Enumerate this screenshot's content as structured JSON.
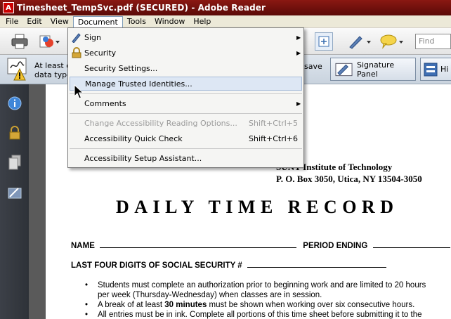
{
  "window": {
    "title": "Timesheet_TempSvc.pdf (SECURED) - Adobe Reader"
  },
  "menubar": {
    "items": [
      "File",
      "Edit",
      "View",
      "Document",
      "Tools",
      "Window",
      "Help"
    ],
    "active": "Document"
  },
  "toolbar": {
    "find_placeholder": "Find",
    "icons": [
      "print-icon",
      "collaborate-icon",
      "fit-page-icon",
      "pen-icon",
      "comment-bubble-icon"
    ]
  },
  "infobar": {
    "message_line1": "At least o",
    "message_line2": "data type",
    "message_right": "save",
    "signature_panel_label": "Signature Panel",
    "highlight_label": "Hi"
  },
  "document_menu": {
    "items": [
      {
        "label": "Sign",
        "submenu": true,
        "icon": "pen-icon"
      },
      {
        "label": "Security",
        "submenu": true,
        "icon": "lock-icon"
      },
      {
        "label": "Security Settings..."
      },
      {
        "label": "Manage Trusted Identities...",
        "highlighted": true
      },
      {
        "label": "Comments",
        "submenu": true
      },
      {
        "label": "Change Accessibility Reading Options...",
        "shortcut": "Shift+Ctrl+5",
        "disabled": true
      },
      {
        "label": "Accessibility Quick Check",
        "shortcut": "Shift+Ctrl+6"
      },
      {
        "label": "Accessibility Setup Assistant..."
      }
    ]
  },
  "navpane": {
    "icons": [
      "info-icon",
      "lock-icon",
      "pages-icon",
      "signatures-icon"
    ]
  },
  "document": {
    "institute": "SUNY Institute of Technology",
    "address": "P. O. Box 3050, Utica, NY 13504-3050",
    "form_title": "DAILY TIME RECORD",
    "name_label": "NAME",
    "period_label": "PERIOD ENDING",
    "ssn_label": "LAST FOUR DIGITS OF SOCIAL SECURITY #",
    "bullet1_line1": "Students must complete an authorization prior to beginning work and are limited to 20 hours",
    "bullet1_line2": "per week (Thursday-Wednesday) when classes are in session.",
    "bullet2_prefix": "A break of at least ",
    "bullet2_bold": "30 minutes",
    "bullet2_suffix": " must be shown when working over six consecutive hours.",
    "bullet3": "All entries must be in ink.  Complete all portions of this time sheet before submitting it to the"
  },
  "colors": {
    "titlebar": "#7a120e",
    "menu_highlight": "#dde7f4",
    "navpane": "#34383f"
  }
}
